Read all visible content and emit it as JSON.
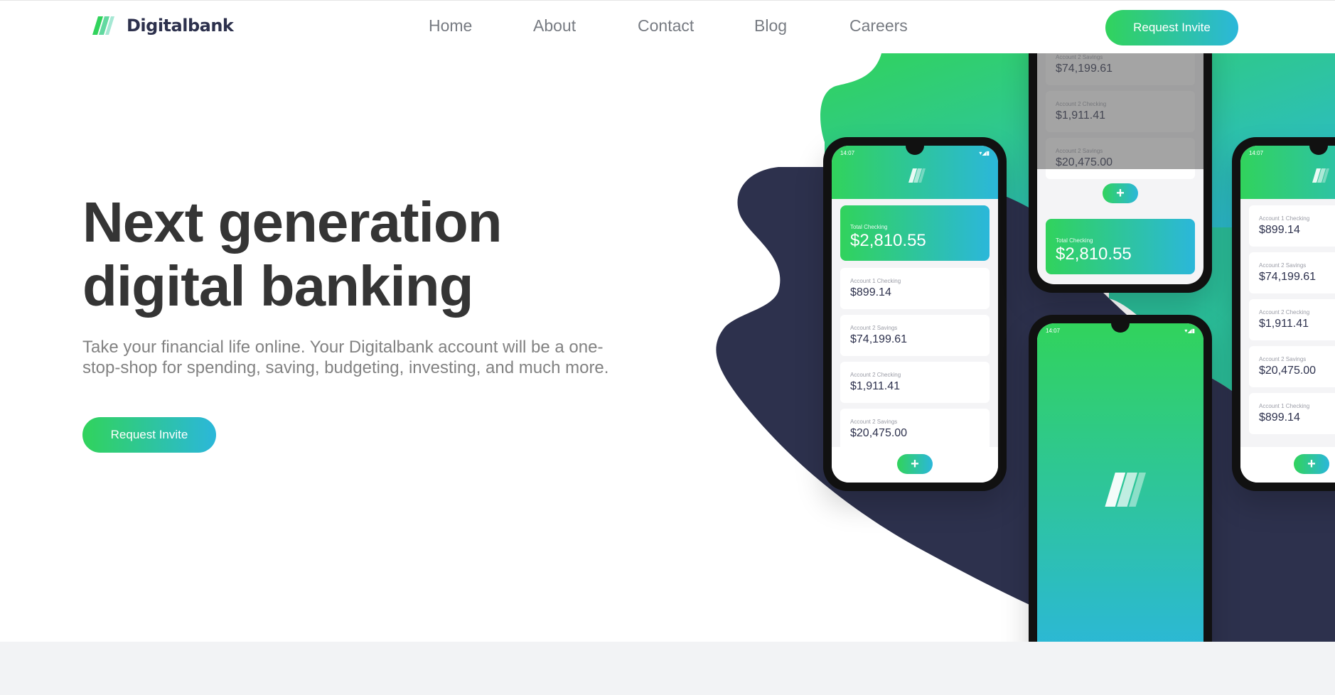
{
  "brand": {
    "name": "Digitalbank"
  },
  "nav": {
    "links": [
      "Home",
      "About",
      "Contact",
      "Blog",
      "Careers"
    ],
    "cta": "Request Invite"
  },
  "hero": {
    "title_line1": "Next generation",
    "title_line2": "digital banking",
    "description": "Take your financial life online. Your Digitalbank account will be a one-stop-shop for spending, saving, budgeting, investing, and much more.",
    "cta": "Request Invite"
  },
  "colors": {
    "green": "#31d35c",
    "cyan": "#2bb7da",
    "navy": "#2d314d",
    "text_dark": "#353535",
    "text_muted": "#828282"
  },
  "phones": {
    "time": "14:07",
    "total_checking_label": "Total Checking",
    "total_checking_value": "$2,810.55",
    "accounts": [
      {
        "label": "Account 1 Checking",
        "value": "$899.14"
      },
      {
        "label": "Account 2 Savings",
        "value": "$74,199.61"
      },
      {
        "label": "Account 2 Checking",
        "value": "$1,911.41"
      },
      {
        "label": "Account 2 Savings",
        "value": "$20,475.00"
      },
      {
        "label": "Account 1 Checking",
        "value": "$899.14"
      }
    ],
    "add_icon": "plus-icon"
  }
}
